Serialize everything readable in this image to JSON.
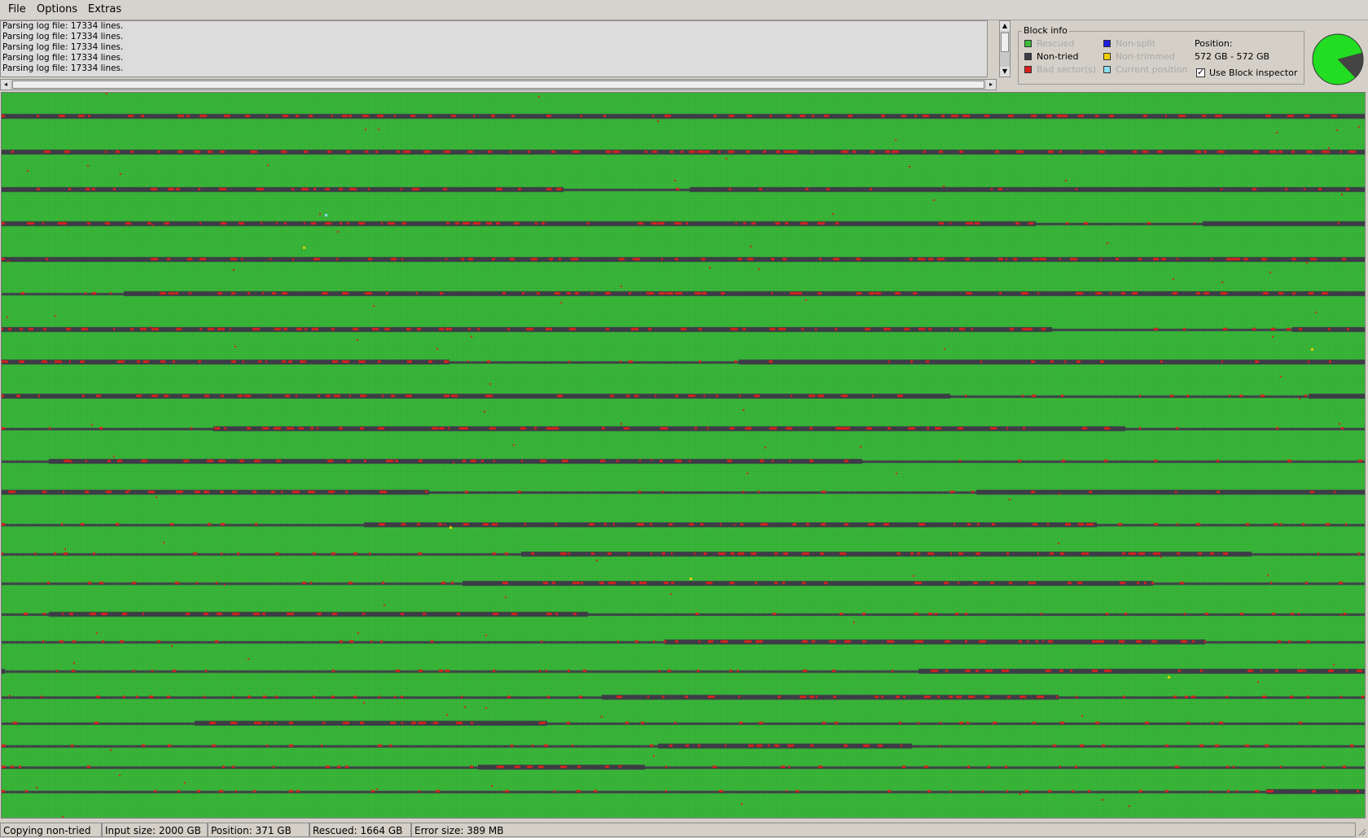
{
  "menu": {
    "file_label": "File",
    "options_label": "Options",
    "extras_label": "Extras"
  },
  "log": {
    "lines": [
      "Parsing log file: 17334 lines.",
      "Parsing log file: 17334 lines.",
      "Parsing log file: 17334 lines.",
      "Parsing log file: 17334 lines.",
      "Parsing log file: 17334 lines."
    ]
  },
  "block_info": {
    "title": "Block info",
    "legend": [
      {
        "label": "Rescued",
        "color": "#3cbb3c",
        "dimmed": true
      },
      {
        "label": "Non-tried",
        "color": "#3c3c46",
        "dimmed": false
      },
      {
        "label": "Bad sector(s)",
        "color": "#d8201c",
        "dimmed": true
      },
      {
        "label": "Non-split",
        "color": "#1c1ce0",
        "dimmed": true
      },
      {
        "label": "Non-trimmed",
        "color": "#f0d000",
        "dimmed": true
      },
      {
        "label": "Current position",
        "color": "#8ce0f0",
        "dimmed": true
      }
    ],
    "position_label": "Position:",
    "position_value": "572 GB - 572 GB",
    "use_block_inspector_label": "Use Block inspector",
    "use_block_inspector_checked": true
  },
  "pie": {
    "rescued_fraction": 0.83,
    "rescued_color": "#22dd22",
    "nontried_color": "#444444"
  },
  "map": {
    "rescued_color": "#3cbb3c",
    "nontried_color": "#3c3c46",
    "bad_color": "#d8201c",
    "nontrimmed_color": "#f0d000",
    "current_color": "#8ce0f0"
  },
  "status": {
    "state": "Copying non-tried",
    "input_size": "Input size: 2000 GB",
    "position": "Position: 371 GB",
    "rescued": "Rescued: 1664 GB",
    "error_size": "Error size: 389 MB"
  }
}
